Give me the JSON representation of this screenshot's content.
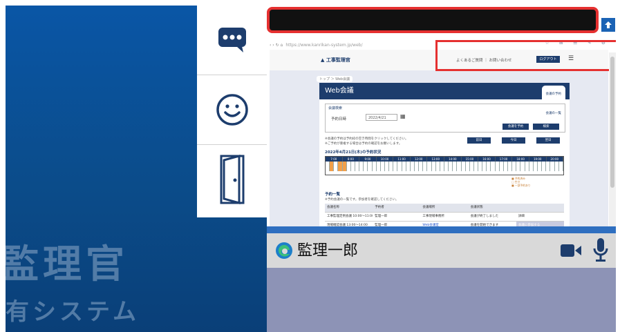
{
  "background": {
    "title": "監理官",
    "subtitle": "有システム",
    "color_main": "#0b4c8a"
  },
  "side_menu": {
    "items": [
      {
        "icon": "chat-bubble-icon"
      },
      {
        "icon": "smiley-face-icon"
      },
      {
        "icon": "exit-door-icon"
      }
    ]
  },
  "shared_screen": {
    "browser_url": "https://www.kanrikan-system.jp/web/",
    "site": {
      "logo": "▲ 工事監理官",
      "nav": "よくあるご質問 ｜ お問い合わせ",
      "login_label": "ログアウト",
      "breadcrumb": "トップ ＞ Web会議",
      "page_title": "Web会議",
      "header_btns": [
        "会議の予約",
        "会議の一覧"
      ],
      "form_title": "会議検索",
      "form_label": "予約日時",
      "form_date": "2022/4/21",
      "form_btns": [
        "会議を予約",
        "検索"
      ],
      "action_btns": [
        "前日",
        "今日",
        "翌日"
      ],
      "note_lines": [
        "※会議の予約は予約枠の空き時間をクリックしてください。",
        "※ご予約が重複する場合は予約の確認をお願いします。"
      ],
      "schedule_title": "2022年4月21日(木)の予約状況",
      "times": [
        "7:00",
        "8:00",
        "9:00",
        "10:00",
        "11:00",
        "12:00",
        "13:00",
        "14:00",
        "15:00",
        "16:00",
        "17:00",
        "18:00",
        "19:00",
        "20:00"
      ],
      "legend": [
        "■ 予約済み",
        "□ 空き",
        "■ 一部予約あり"
      ],
      "results_title": "予約一覧",
      "results_note": "※予約会議の一覧です。参加者を確認してください。",
      "table_headers": [
        "会議名称",
        "予約者",
        "会議場所",
        "会議状態",
        ""
      ],
      "table_rows": [
        [
          "工事監理定例会議 10:00～11:00",
          "監理一郎",
          "工事現場事務所",
          "会議が終了しました",
          "詳細"
        ],
        [
          "現場確認会議 13:00～14:00",
          "監理一郎",
          "Web会議室",
          "会議を開始できます",
          "会議に参加する"
        ]
      ]
    }
  },
  "video_bar": {
    "user_name": "監理一郎"
  }
}
